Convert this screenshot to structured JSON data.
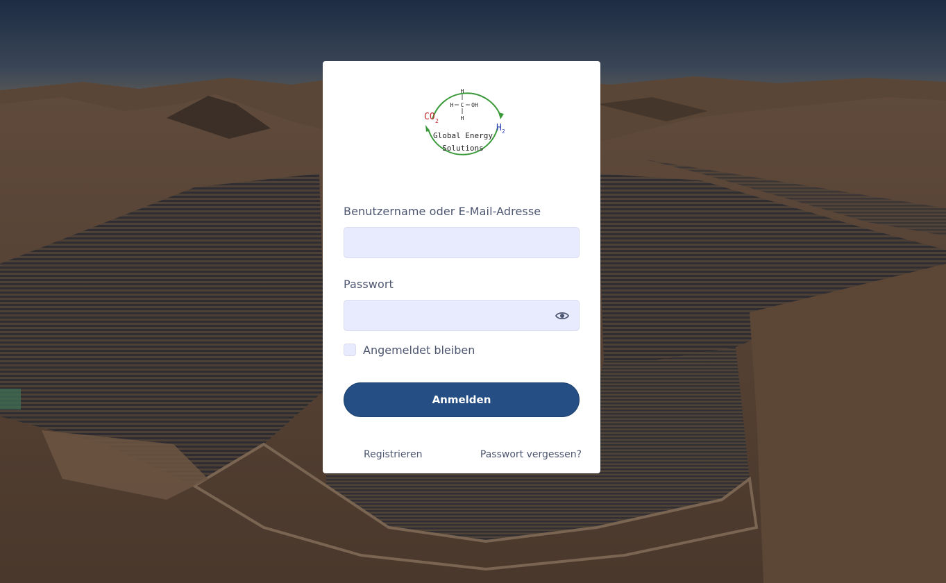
{
  "brand": {
    "logo": {
      "name_line1": "Global Energy",
      "name_line2": "Solutions",
      "co2_label": "CO",
      "co2_sub": "2",
      "h2_label": "H",
      "h2_sub": "2",
      "accent_ring": "#3a9a3a",
      "co2_color": "#c0282d",
      "h2_color": "#2b3fb5"
    }
  },
  "login": {
    "username_label": "Benutzername oder E-Mail-Adresse",
    "username_value": "",
    "password_label": "Passwort",
    "password_value": "",
    "show_password_icon": "eye-icon",
    "remember_label": "Angemeldet bleiben",
    "remember_checked": false,
    "submit_label": "Anmelden",
    "register_link": "Registrieren",
    "forgot_link": "Passwort vergessen?"
  },
  "theme": {
    "primary": "#254f84",
    "input_bg": "#e8eafe",
    "text": "#4d5670"
  }
}
